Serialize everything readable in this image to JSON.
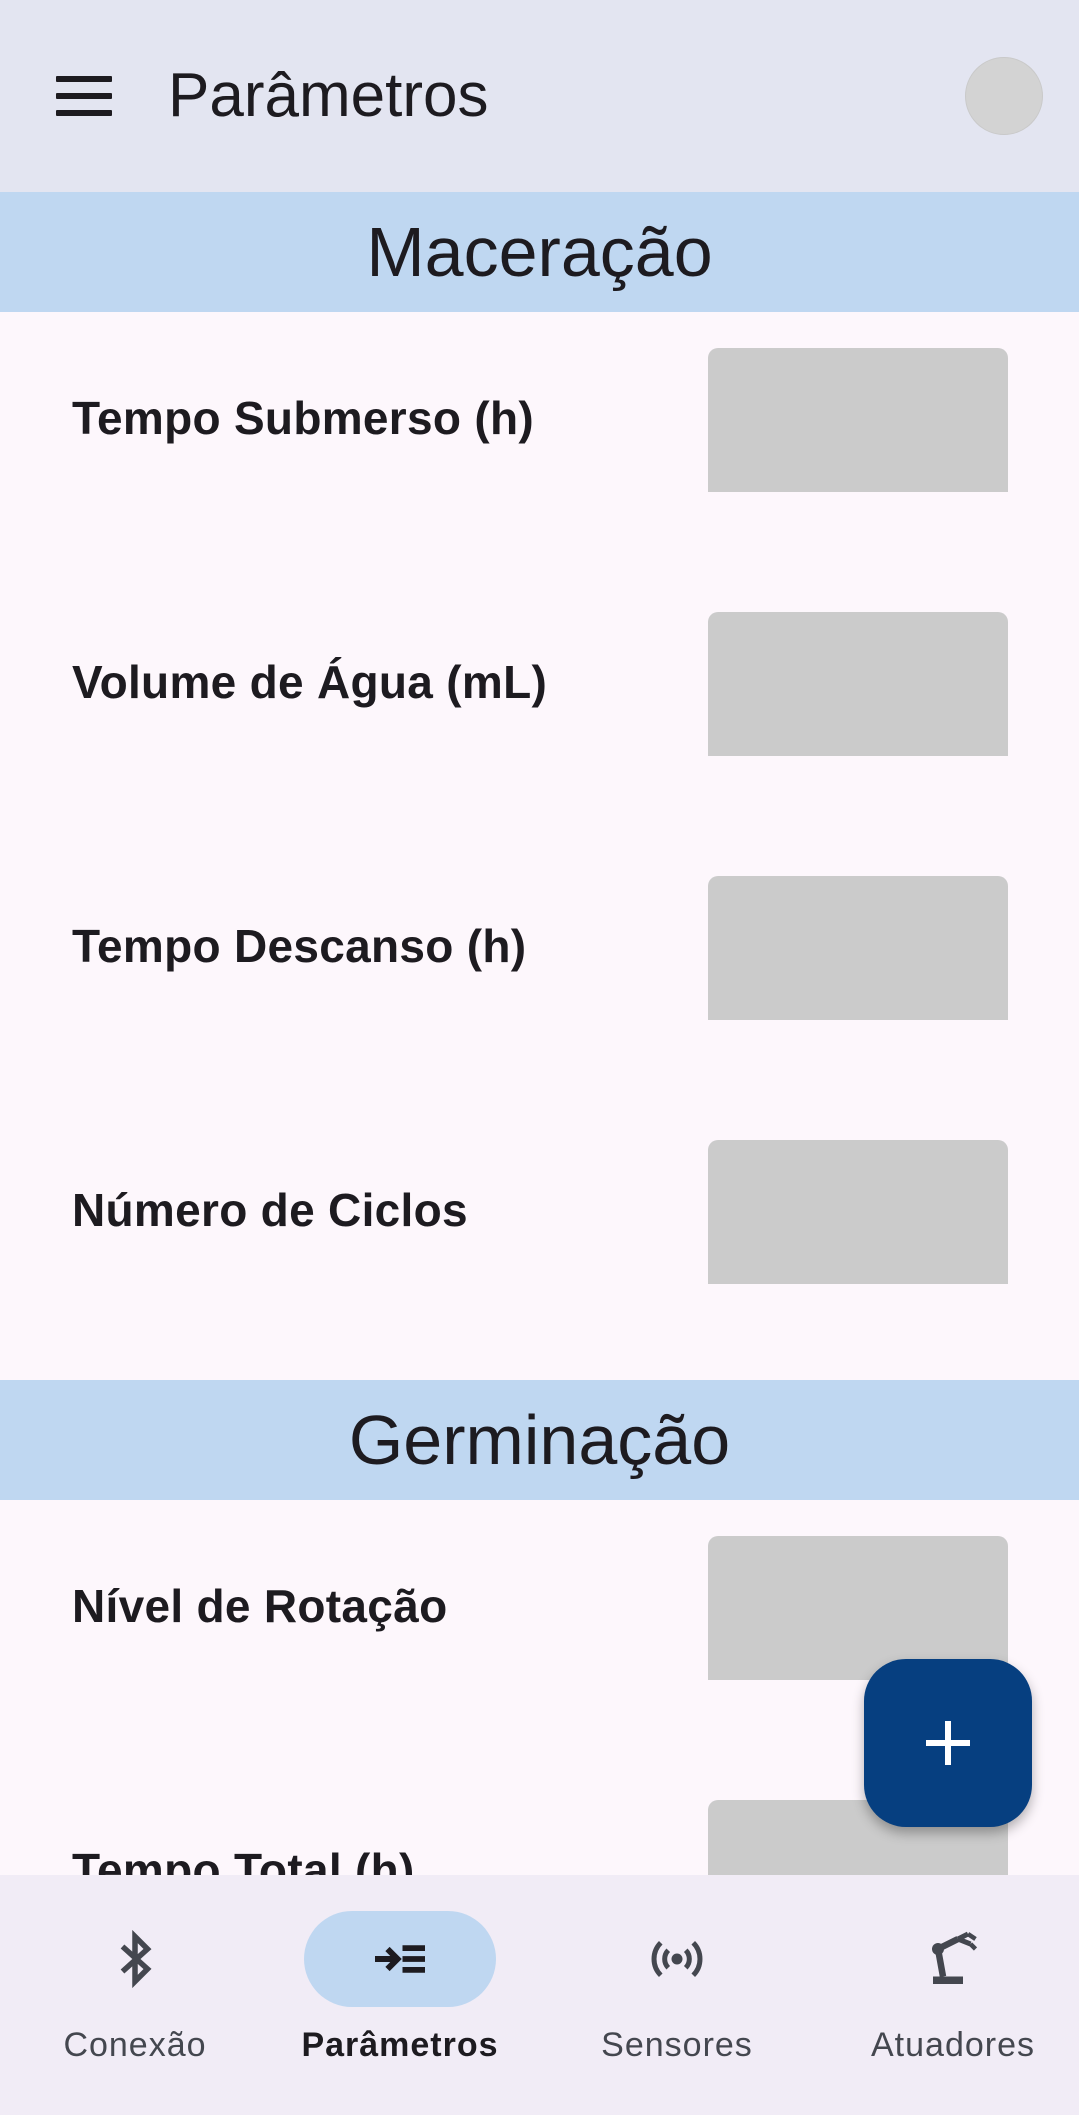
{
  "appbar": {
    "title": "Parâmetros"
  },
  "sections": [
    {
      "title": "Maceração",
      "rows": [
        {
          "label": "Tempo Submerso (h)",
          "value": ""
        },
        {
          "label": "Volume de Água (mL)",
          "value": ""
        },
        {
          "label": "Tempo Descanso (h)",
          "value": ""
        },
        {
          "label": "Número de Ciclos",
          "value": ""
        }
      ]
    },
    {
      "title": "Germinação",
      "rows": [
        {
          "label": "Nível de Rotação",
          "value": ""
        },
        {
          "label": "Tempo Total (h)",
          "value": ""
        }
      ]
    }
  ],
  "nav": {
    "items": [
      {
        "label": "Conexão",
        "icon": "bluetooth-icon",
        "active": false
      },
      {
        "label": "Parâmetros",
        "icon": "parameters-icon",
        "active": true
      },
      {
        "label": "Sensores",
        "icon": "sensor-icon",
        "active": false
      },
      {
        "label": "Atuadores",
        "icon": "robot-arm-icon",
        "active": false
      }
    ]
  },
  "fab": {
    "icon": "plus-icon"
  },
  "colors": {
    "appbar_bg": "#e3e5f1",
    "section_header_bg": "#bfd7f1",
    "field_bg": "#cbcbcb",
    "fab_bg": "#063f80",
    "nav_bg": "#f1ecf6",
    "active_pill": "#bfd7f1"
  }
}
